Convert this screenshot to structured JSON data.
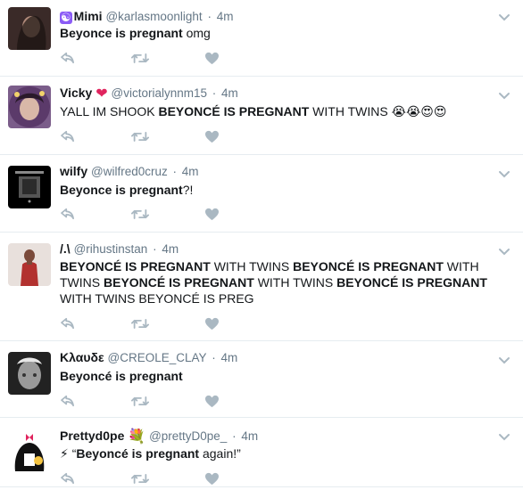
{
  "tweets": [
    {
      "name": "Mimi",
      "name_emoji": "☯",
      "handle": "@karlasmoonlight",
      "time": "4m",
      "text": [
        {
          "b": true,
          "t": "Beyonce is pregnant"
        },
        {
          "b": false,
          "t": " omg"
        }
      ],
      "avatar_colors": [
        "#3a2a28",
        "#b08a7a"
      ]
    },
    {
      "name": "Vicky",
      "name_emoji": "❤",
      "handle": "@victorialynnm15",
      "time": "4m",
      "text": [
        {
          "b": false,
          "t": "YALL IM SHOOK "
        },
        {
          "b": true,
          "t": "BEYONCÉ IS PREGNANT"
        },
        {
          "b": false,
          "t": " WITH TWINS 😭😭😍😍"
        }
      ],
      "avatar_colors": [
        "#5b3a6a",
        "#d9b8a8"
      ]
    },
    {
      "name": "wilfy",
      "name_emoji": "",
      "handle": "@wilfred0cruz",
      "time": "4m",
      "text": [
        {
          "b": true,
          "t": "Beyonce is pregnant"
        },
        {
          "b": false,
          "t": "?!"
        }
      ],
      "avatar_colors": [
        "#000000",
        "#555555"
      ]
    },
    {
      "name": "/.\\",
      "name_emoji": "",
      "handle": "@rihustinstan",
      "time": "4m",
      "text": [
        {
          "b": true,
          "t": "BEYONCÉ IS PREGNANT"
        },
        {
          "b": false,
          "t": " WITH TWINS "
        },
        {
          "b": true,
          "t": "BEYONCÉ IS PREGNANT"
        },
        {
          "b": false,
          "t": " WITH TWINS "
        },
        {
          "b": true,
          "t": "BEYONCÉ IS PREGNANT"
        },
        {
          "b": false,
          "t": " WITH TWINS "
        },
        {
          "b": true,
          "t": "BEYONCÉ IS PREGNANT"
        },
        {
          "b": false,
          "t": " WITH TWINS BEYONCÉ IS PREG"
        }
      ],
      "avatar_colors": [
        "#e8e0dc",
        "#b2312f"
      ]
    },
    {
      "name": "Κλαυδε",
      "name_emoji": "",
      "handle": "@CREOLE_CLAY",
      "time": "4m",
      "text": [
        {
          "b": true,
          "t": "Beyoncé is pregnant"
        }
      ],
      "avatar_colors": [
        "#222222",
        "#9a9a9a"
      ]
    },
    {
      "name": "Prettyd0pe",
      "name_emoji": "💐",
      "handle": "@prettyD0pe_",
      "time": "4m",
      "text": [
        {
          "b": false,
          "t": "⚡ “"
        },
        {
          "b": true,
          "t": "Beyoncé is pregnant"
        },
        {
          "b": false,
          "t": " again!”"
        }
      ],
      "avatar_colors": [
        "#ffffff",
        "#111111"
      ]
    }
  ],
  "icons": {
    "reply": "reply-icon",
    "retweet": "retweet-icon",
    "like": "heart-icon",
    "more": "chevron-down-icon"
  },
  "colors": {
    "action_gray": "#aab8c2",
    "heart_red": "#e0245e",
    "muted": "#657786"
  }
}
